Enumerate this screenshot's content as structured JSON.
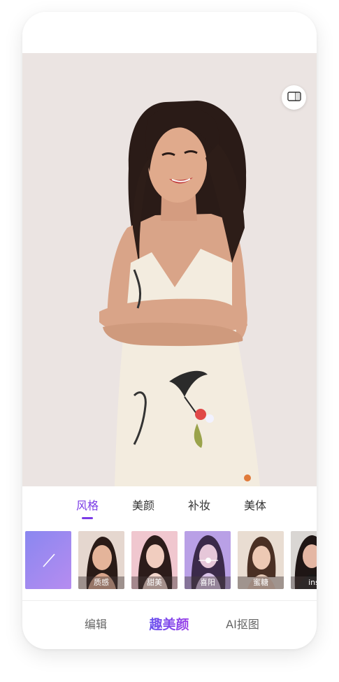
{
  "tabs": [
    {
      "label": "风格",
      "active": true
    },
    {
      "label": "美颜",
      "active": false
    },
    {
      "label": "补妆",
      "active": false
    },
    {
      "label": "美体",
      "active": false
    }
  ],
  "filters": [
    {
      "label": "",
      "icon": "none-slash-icon"
    },
    {
      "label": "质感"
    },
    {
      "label": "甜美"
    },
    {
      "label": "喜阳"
    },
    {
      "label": "蜜糖"
    },
    {
      "label": "ins"
    }
  ],
  "bottom_nav": [
    {
      "label": "编辑",
      "active": false
    },
    {
      "label": "趣美颜",
      "active": true
    },
    {
      "label": "AI抠图",
      "active": false
    }
  ],
  "colors": {
    "accent": "#7a3be6",
    "gradient_start": "#5b57f0",
    "gradient_end": "#a83be6"
  },
  "icons": {
    "compare": "compare-icon"
  }
}
